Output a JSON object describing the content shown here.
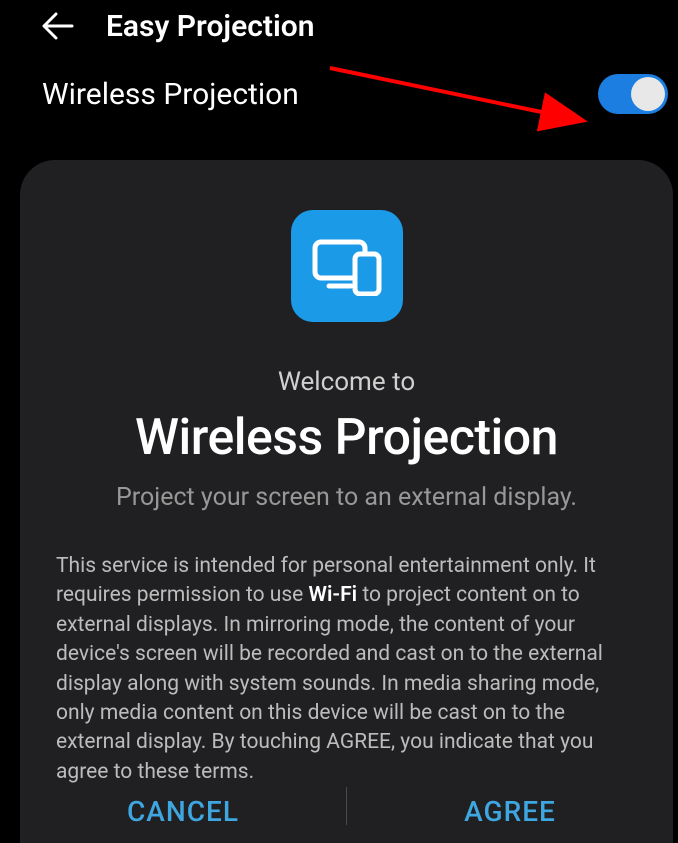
{
  "header": {
    "title": "Easy Projection"
  },
  "setting": {
    "label": "Wireless Projection",
    "enabled": true
  },
  "dialog": {
    "welcome": "Welcome to",
    "title": "Wireless Projection",
    "subtitle": "Project your screen to an external display.",
    "body_pre": "This service is intended for personal entertainment only. It requires permission to use ",
    "body_bold": "Wi-Fi",
    "body_post": " to project content on to external displays. In mirroring mode, the content of your device's screen will be recorded and cast on to the external display along with system sounds. In media sharing mode, only media content on this device will be cast on to the external display. By touching AGREE, you indicate that you agree to these terms.",
    "cancel": "CANCEL",
    "agree": "AGREE"
  },
  "icons": {
    "back": "arrow-left",
    "app": "projection-icon"
  },
  "colors": {
    "accent": "#1b9ae8",
    "toggle": "#1b7ee0",
    "annotation": "#ff0000"
  }
}
